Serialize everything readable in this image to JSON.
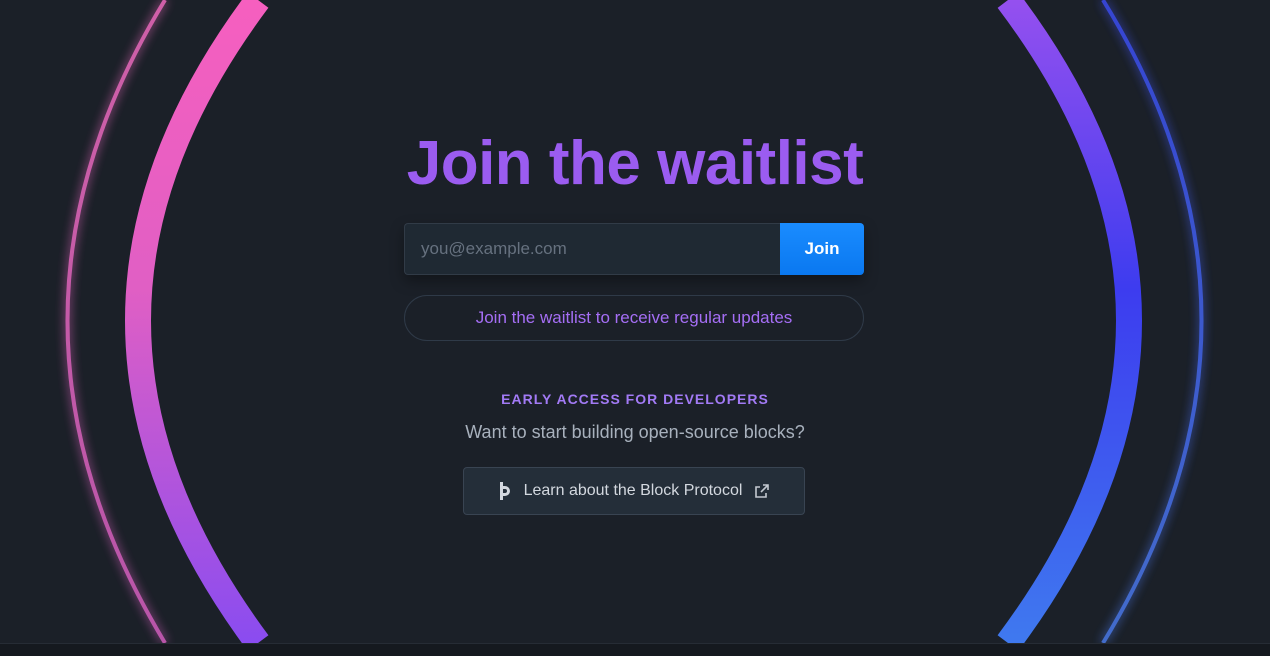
{
  "waitlist": {
    "title": "Join the waitlist",
    "email_placeholder": "you@example.com",
    "join_label": "Join",
    "updates_label": "Join the waitlist to receive regular updates"
  },
  "developers": {
    "eyebrow": "EARLY ACCESS FOR DEVELOPERS",
    "subtitle": "Want to start building open-source blocks?",
    "button_label": "Learn about the Block Protocol",
    "button_icon": "block-protocol-logo-icon",
    "external_icon": "external-link-icon"
  },
  "colors": {
    "background": "#1b2028",
    "accent_purple": "#9b5cf0",
    "join_blue": "#0a78f0",
    "ring_pink": "#f45fbf",
    "ring_blue": "#3b4cf0"
  }
}
